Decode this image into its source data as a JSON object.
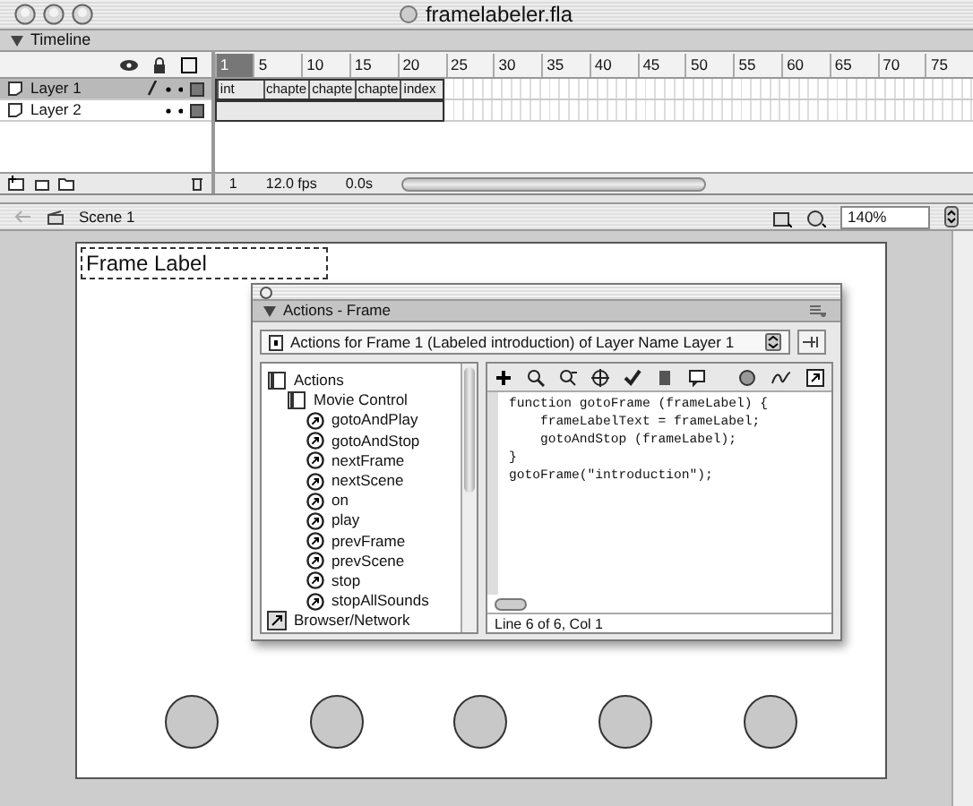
{
  "window": {
    "title": "framelabeler.fla"
  },
  "timeline": {
    "title": "Timeline",
    "expanded": true,
    "ruler": [
      "1",
      "5",
      "10",
      "15",
      "20",
      "25",
      "30",
      "35",
      "40",
      "45",
      "50",
      "55",
      "60",
      "65",
      "70",
      "75"
    ],
    "layers": [
      {
        "name": "Layer 1",
        "selected": true,
        "editable": true,
        "labels": [
          "int",
          "chapte",
          "chapte",
          "chapte",
          "index"
        ]
      },
      {
        "name": "Layer 2",
        "selected": false,
        "editable": false
      }
    ],
    "current_frame": "1",
    "fps": "12.0 fps",
    "time": "0.0s"
  },
  "edit_bar": {
    "scene": "Scene 1",
    "zoom": "140%"
  },
  "stage": {
    "text_field": "Frame Label",
    "circles": [
      {
        "kind": "circle"
      },
      {
        "kind": "circle"
      },
      {
        "kind": "circle"
      },
      {
        "kind": "circle"
      },
      {
        "kind": "circle"
      }
    ]
  },
  "actions_panel": {
    "title": "Actions - Frame",
    "expanded": true,
    "target": "Actions for Frame 1 (Labeled introduction)  of Layer Name Layer 1",
    "toolbox": [
      {
        "label": "Actions",
        "expanded": true,
        "children": [
          {
            "label": "Movie Control",
            "expanded": true,
            "children": [
              {
                "label": "gotoAndPlay"
              },
              {
                "label": "gotoAndStop"
              },
              {
                "label": "nextFrame"
              },
              {
                "label": "nextScene"
              },
              {
                "label": "on"
              },
              {
                "label": "play"
              },
              {
                "label": "prevFrame"
              },
              {
                "label": "prevScene"
              },
              {
                "label": "stop"
              },
              {
                "label": "stopAllSounds"
              }
            ]
          }
        ]
      },
      {
        "label": "Browser/Network",
        "expanded": false
      }
    ],
    "code": [
      "function gotoFrame (frameLabel) {",
      "    frameLabelText = frameLabel;",
      "    gotoAndStop (frameLabel);",
      "}",
      "gotoFrame(\"introduction\");"
    ],
    "status": "Line 6 of 6, Col 1"
  }
}
